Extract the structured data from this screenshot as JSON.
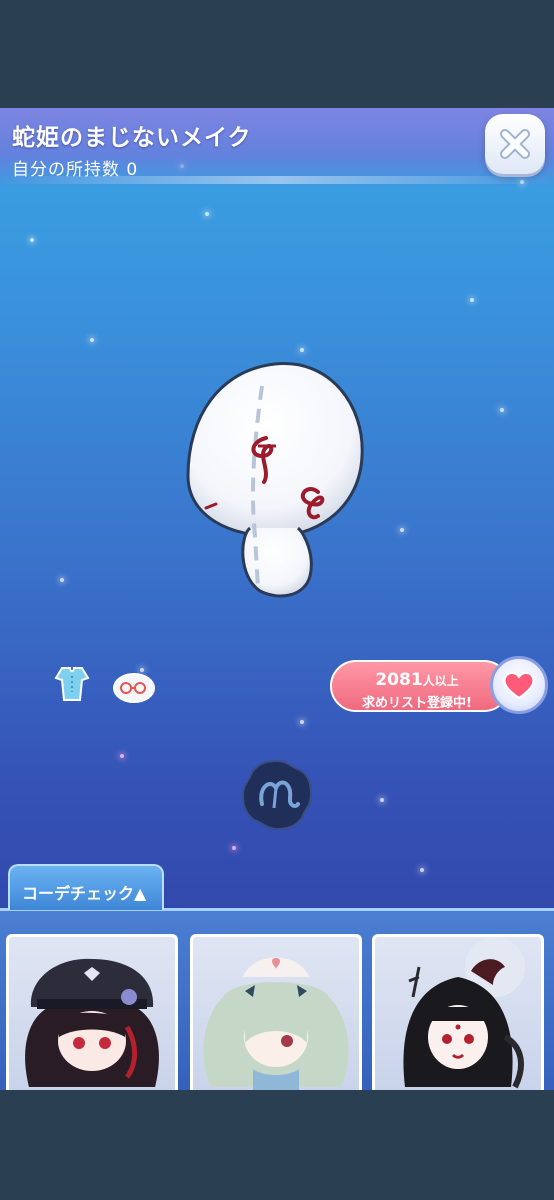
{
  "header": {
    "title": "蛇姫のまじないメイク",
    "owned_label": "自分の所持数 0"
  },
  "close_button": {
    "icon": "close-icon"
  },
  "item": {
    "name": "蛇姫のまじないメイク",
    "icon": "face-makeup-item-icon"
  },
  "related_icons": [
    {
      "icon": "baby-romper-icon"
    },
    {
      "icon": "glasses-hat-icon"
    }
  ],
  "coordinate_icon": {
    "icon": "coordinate-badge-icon"
  },
  "wishlist": {
    "count": "2081",
    "unit": "人以上",
    "status": "求めリスト登録中!",
    "icon": "heart-icon",
    "heart_color": "#ff5a78"
  },
  "coordinate_check": {
    "tab_label": "コーデチェック▲",
    "cards": [
      {
        "icon": "avatar-dark-captain-icon"
      },
      {
        "icon": "avatar-green-twintail-nurse-icon"
      },
      {
        "icon": "avatar-black-hair-demon-icon"
      }
    ]
  },
  "colors": {
    "header_bg": "#7b83dc",
    "stage_top": "#3aa3e4",
    "stage_bottom": "#3249ac",
    "wish_pill": "#f06a7f",
    "tab_blue": "#3f86d6"
  }
}
